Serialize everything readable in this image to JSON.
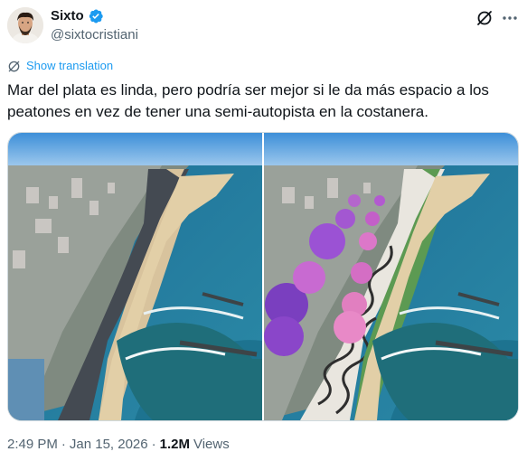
{
  "author": {
    "display_name": "Sixto",
    "handle": "@sixtocristiani",
    "verified": true
  },
  "translation": {
    "label": "Show translation"
  },
  "tweet": {
    "text": "Mar del plata es linda, pero podría ser mejor si le da más espacio a los\npeatones en vez de tener una semi-autopista en la costanera."
  },
  "meta": {
    "time": "2:49 PM",
    "date": "Jan 15, 2026",
    "separator": "·",
    "views_count": "1.2M",
    "views_label": "Views"
  },
  "icons": {
    "verified": "verified-badge-icon",
    "grok": "grok-icon",
    "more": "more-icon",
    "translate": "translate-icon"
  },
  "colors": {
    "accent": "#1d9bf0",
    "text_primary": "#0f1419",
    "text_secondary": "#536471",
    "border": "#cfd9de"
  }
}
